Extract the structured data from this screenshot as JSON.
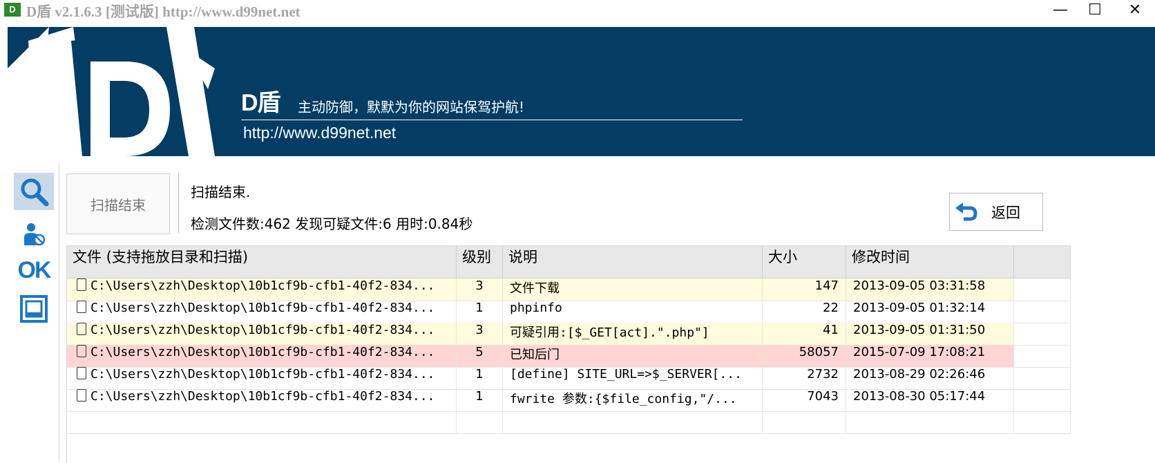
{
  "window": {
    "icon_text": "D",
    "title": "D盾 v2.1.6.3 [测试版] http://www.d99net.net",
    "minimize": "—",
    "maximize": "☐",
    "close": "✕"
  },
  "banner": {
    "brand": "D盾",
    "slogan": "主动防御，默默为你的网站保驾护航!",
    "url": "http://www.d99net.net"
  },
  "toolbar": {
    "items": [
      {
        "name": "scan",
        "icon": "search-icon",
        "active": true
      },
      {
        "name": "user",
        "icon": "user-shield-icon",
        "active": false
      },
      {
        "name": "ok",
        "icon": "ok-icon",
        "label": "OK",
        "active": false
      },
      {
        "name": "box",
        "icon": "window-icon",
        "active": false
      }
    ]
  },
  "scan": {
    "button_label": "扫描结束",
    "status_title": "扫描结束.",
    "status_detail": "检测文件数:462 发现可疑文件:6 用时:0.84秒",
    "back_label": "返回"
  },
  "table": {
    "columns": [
      "文件 (支持拖放目录和扫描)",
      "级别",
      "说明",
      "大小",
      "修改时间"
    ],
    "rows": [
      {
        "file": "C:\\Users\\zzh\\Desktop\\10b1cf9b-cfb1-40f2-834...",
        "level": "3",
        "desc": "文件下载",
        "size": "147",
        "time": "2013-09-05 03:31:58",
        "highlight": "yellow"
      },
      {
        "file": "C:\\Users\\zzh\\Desktop\\10b1cf9b-cfb1-40f2-834...",
        "level": "1",
        "desc": "phpinfo",
        "size": "22",
        "time": "2013-09-05 01:32:14",
        "highlight": "none"
      },
      {
        "file": "C:\\Users\\zzh\\Desktop\\10b1cf9b-cfb1-40f2-834...",
        "level": "3",
        "desc": "可疑引用:[$_GET[act].\".php\"]",
        "size": "41",
        "time": "2013-09-05 01:31:50",
        "highlight": "yellow"
      },
      {
        "file": "C:\\Users\\zzh\\Desktop\\10b1cf9b-cfb1-40f2-834...",
        "level": "5",
        "desc": "已知后门",
        "size": "58057",
        "time": "2015-07-09 17:08:21",
        "highlight": "red"
      },
      {
        "file": "C:\\Users\\zzh\\Desktop\\10b1cf9b-cfb1-40f2-834...",
        "level": "1",
        "desc": "[define] SITE_URL=>$_SERVER[...",
        "size": "2732",
        "time": "2013-08-29 02:26:46",
        "highlight": "none"
      },
      {
        "file": "C:\\Users\\zzh\\Desktop\\10b1cf9b-cfb1-40f2-834...",
        "level": "1",
        "desc": "fwrite 参数:{$file_config,\"/...",
        "size": "7043",
        "time": "2013-08-30 05:17:44",
        "highlight": "none"
      }
    ]
  }
}
